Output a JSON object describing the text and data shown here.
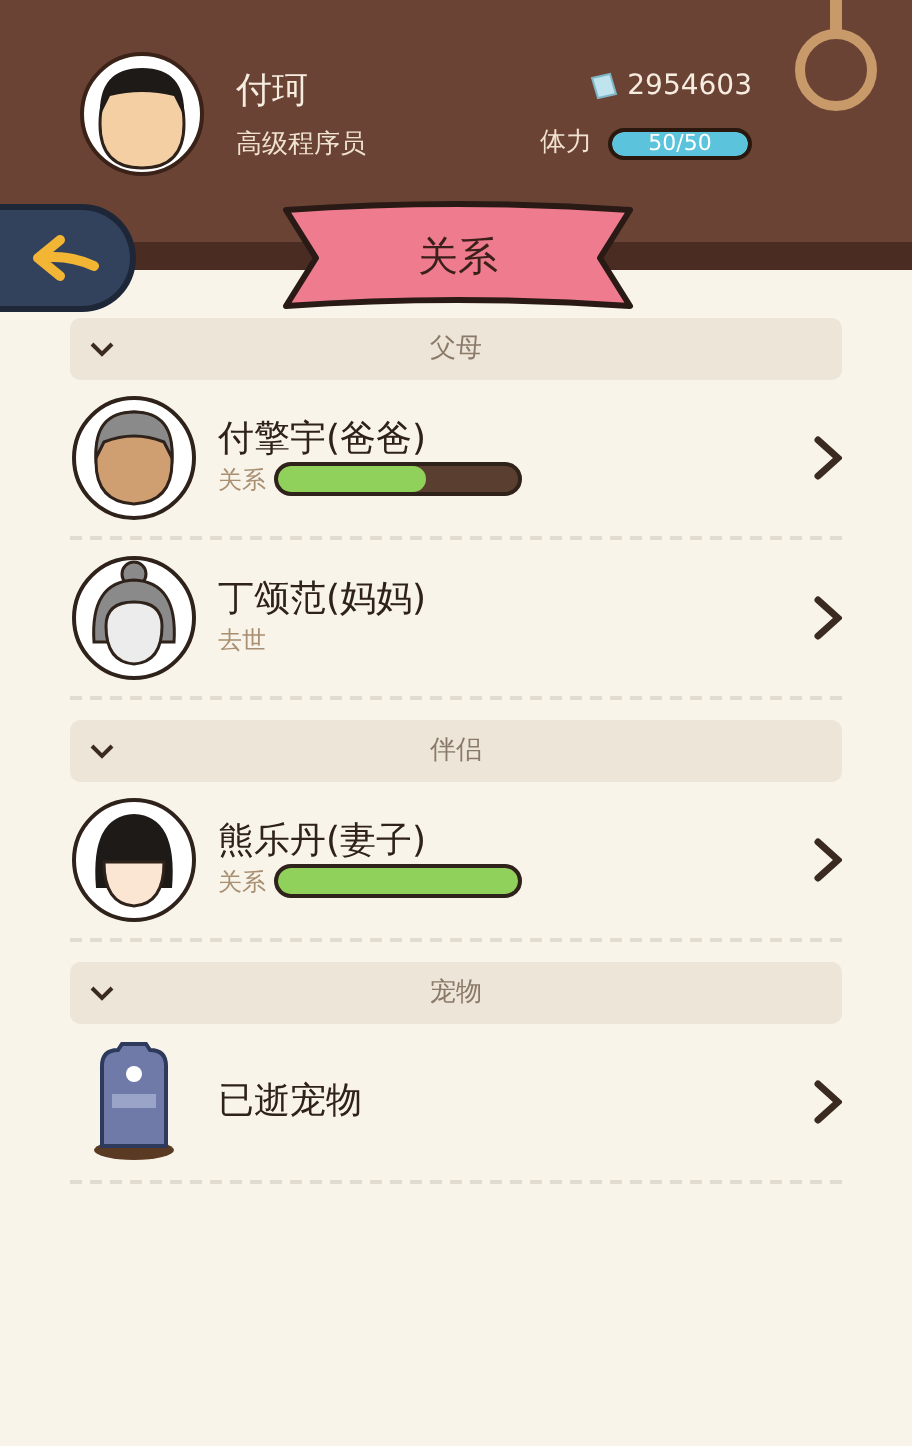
{
  "player": {
    "name": "付珂",
    "title": "高级程序员",
    "money": "2954603",
    "stamina_label": "体力",
    "stamina": "50/50",
    "level": 1
  },
  "page_title": "关系",
  "sections": [
    {
      "title": "父母",
      "expanded": true,
      "members": [
        {
          "name": "付擎宇(爸爸)",
          "kind": "old_man",
          "sub": "关系",
          "level": 0.62
        },
        {
          "name": "丁颂范(妈妈)",
          "kind": "old_woman",
          "sub": "去世"
        }
      ]
    },
    {
      "title": "伴侣",
      "expanded": true,
      "members": [
        {
          "name": "熊乐丹(妻子)",
          "kind": "woman",
          "sub": "关系",
          "level": 1
        }
      ]
    },
    {
      "title": "宠物",
      "expanded": true,
      "members": [
        {
          "name": "已逝宠物",
          "kind": "tombstone"
        }
      ]
    }
  ]
}
